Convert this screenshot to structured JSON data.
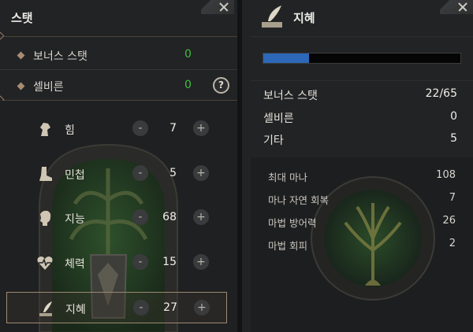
{
  "left": {
    "title": "스탯",
    "bonus_stat_label": "보너스 스탯",
    "bonus_stat_value": "0",
    "sephiron_label": "셀비른",
    "sephiron_value": "0",
    "help_icon": "?",
    "stats": [
      {
        "label": "힘",
        "value": "7",
        "icon": "horse-head-icon"
      },
      {
        "label": "민첩",
        "value": "5",
        "icon": "boot-icon"
      },
      {
        "label": "지능",
        "value": "68",
        "icon": "head-profile-icon"
      },
      {
        "label": "체력",
        "value": "15",
        "icon": "heart-icon"
      },
      {
        "label": "지혜",
        "value": "27",
        "icon": "quill-icon"
      }
    ],
    "minus": "-",
    "plus": "+"
  },
  "right": {
    "title": "지혜",
    "mana_fill_fraction": 0.23,
    "bonus_stat_label": "보너스 스탯",
    "bonus_stat_value": "22/65",
    "sephiron_label": "셀비른",
    "sephiron_value": "0",
    "etc_label": "기타",
    "etc_value": "5",
    "details": [
      {
        "label": "최대 마나",
        "value": "108"
      },
      {
        "label": "마나 자연 회복",
        "value": "7"
      },
      {
        "label": "마법 방어력",
        "value": "26"
      },
      {
        "label": "마법 회피",
        "value": "2"
      }
    ]
  },
  "colors": {
    "accent_green": "#3fbf3f",
    "mana_blue": "#2c67b8",
    "selection_border": "#9b8a70"
  }
}
